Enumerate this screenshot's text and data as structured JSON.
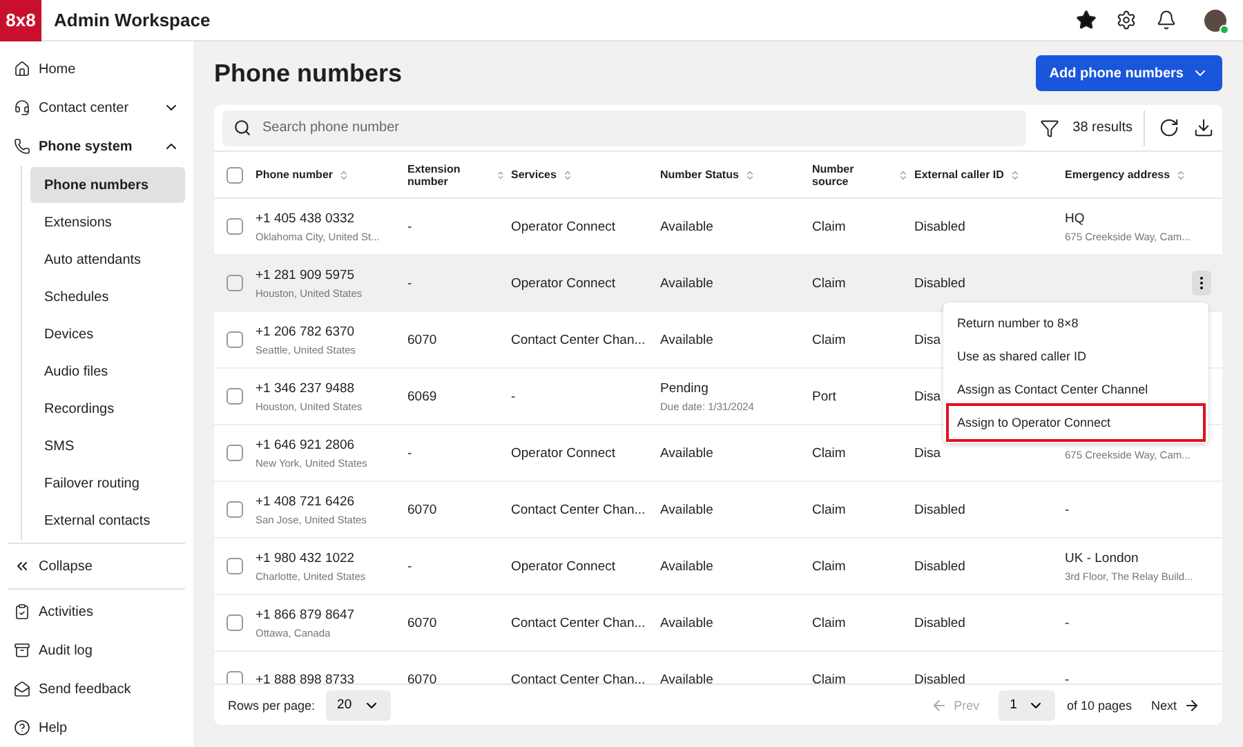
{
  "app": {
    "logo": "8x8",
    "title": "Admin Workspace"
  },
  "sidebar": {
    "items": [
      {
        "label": "Home"
      },
      {
        "label": "Contact center",
        "expanded": false
      },
      {
        "label": "Phone system",
        "expanded": true,
        "children": [
          {
            "label": "Phone numbers",
            "selected": true
          },
          {
            "label": "Extensions",
            "selected": false
          },
          {
            "label": "Auto attendants",
            "selected": false
          },
          {
            "label": "Schedules",
            "selected": false
          },
          {
            "label": "Devices",
            "selected": false
          },
          {
            "label": "Audio files",
            "selected": false
          },
          {
            "label": "Recordings",
            "selected": false
          },
          {
            "label": "SMS",
            "selected": false
          },
          {
            "label": "Failover routing",
            "selected": false
          },
          {
            "label": "External contacts",
            "selected": false
          }
        ]
      }
    ],
    "collapse": "Collapse",
    "footer": [
      {
        "label": "Activities"
      },
      {
        "label": "Audit log"
      },
      {
        "label": "Send feedback"
      },
      {
        "label": "Help"
      }
    ]
  },
  "page": {
    "title": "Phone numbers",
    "add_button": "Add phone numbers"
  },
  "toolbar": {
    "search_placeholder": "Search phone number",
    "results": "38 results"
  },
  "table": {
    "all_checked": false,
    "columns": [
      "Phone number",
      "Extension number",
      "Services",
      "Number Status",
      "Number source",
      "External caller ID",
      "Emergency address"
    ],
    "rows": [
      {
        "number": "+1 405 438 0332",
        "location": "Oklahoma City, United St...",
        "extension": "-",
        "services": "Operator Connect",
        "status": "Available",
        "source": "Claim",
        "caller_id": "Disabled",
        "address_name": "HQ",
        "address": "675 Creekside Way, Cam...",
        "checked": false,
        "hovered": false
      },
      {
        "number": "+1 281 909 5975",
        "location": "Houston, United States",
        "extension": "-",
        "services": "Operator Connect",
        "status": "Available",
        "source": "Claim",
        "caller_id": "Disabled",
        "checked": false,
        "hovered": true
      },
      {
        "number": "+1 206 782 6370",
        "location": "Seattle, United States",
        "extension": "6070",
        "services": "Contact Center Chan...",
        "status": "Available",
        "source": "Claim",
        "caller_id": "Disa",
        "checked": false,
        "hovered": false
      },
      {
        "number": "+1 346 237 9488",
        "location": "Houston, United States",
        "extension": "6069",
        "services": "-",
        "status": "Pending",
        "status_note": "Due date: 1/31/2024",
        "source": "Port",
        "caller_id": "Disa",
        "checked": false,
        "hovered": false
      },
      {
        "number": "+1 646 921 2806",
        "location": "New York, United States",
        "extension": "-",
        "services": "Operator Connect",
        "status": "Available",
        "source": "Claim",
        "caller_id": "Disa",
        "address": "675 Creekside Way, Cam...",
        "checked": false,
        "hovered": false
      },
      {
        "number": "+1 408 721 6426",
        "location": "San Jose, United States",
        "extension": "6070",
        "services": "Contact Center Chan...",
        "status": "Available",
        "source": "Claim",
        "caller_id": "Disabled",
        "address_name": "-",
        "checked": false,
        "hovered": false
      },
      {
        "number": "+1 980 432 1022",
        "location": "Charlotte, United States",
        "extension": "-",
        "services": "Operator Connect",
        "status": "Available",
        "source": "Claim",
        "caller_id": "Disabled",
        "address_name": "UK - London",
        "address": "3rd Floor, The Relay Build...",
        "checked": false,
        "hovered": false
      },
      {
        "number": "+1 866 879 8647",
        "location": "Ottawa, Canada",
        "extension": "6070",
        "services": "Contact Center Chan...",
        "status": "Available",
        "source": "Claim",
        "caller_id": "Disabled",
        "address_name": "-",
        "checked": false,
        "hovered": false
      },
      {
        "number": "+1 888 898 8733",
        "extension": "6070",
        "services": "Contact Center Chan...",
        "status": "Available",
        "source": "Claim",
        "caller_id": "Disabled",
        "address_name": "-",
        "checked": false,
        "hovered": false
      }
    ]
  },
  "context_menu": [
    {
      "label": "Return number to 8×8",
      "highlighted": false
    },
    {
      "label": "Use as shared caller ID",
      "highlighted": false
    },
    {
      "label": "Assign as Contact Center Channel",
      "highlighted": false
    },
    {
      "label": "Assign to Operator Connect",
      "highlighted": true
    }
  ],
  "pagination": {
    "rows_label": "Rows per page:",
    "rows_value": "20",
    "prev": "Prev",
    "page": "1",
    "of_pages": "of 10 pages",
    "next": "Next"
  }
}
